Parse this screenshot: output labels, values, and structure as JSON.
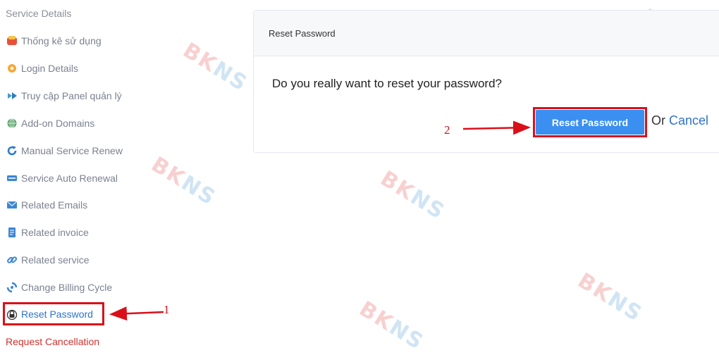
{
  "sidebar": {
    "header": "Service Details",
    "items": [
      {
        "label": "Thống kê sử dụng",
        "icon": "chart-icon"
      },
      {
        "label": "Login Details",
        "icon": "gear-icon"
      },
      {
        "label": "Truy cập Panel quản lý",
        "icon": "arrow-right-icon"
      },
      {
        "label": "Add-on Domains",
        "icon": "globe-icon"
      },
      {
        "label": "Manual Service Renew",
        "icon": "refresh-icon"
      },
      {
        "label": "Service Auto Renewal",
        "icon": "auto-badge-icon"
      },
      {
        "label": "Related Emails",
        "icon": "envelope-icon"
      },
      {
        "label": "Related invoice",
        "icon": "document-icon"
      },
      {
        "label": "Related service",
        "icon": "link-icon"
      },
      {
        "label": "Change Billing Cycle",
        "icon": "cycle-icon"
      },
      {
        "label": "Reset Password",
        "icon": "lock-icon"
      },
      {
        "label": "Request Cancellation",
        "icon": ""
      }
    ]
  },
  "panel": {
    "title": "Reset Password",
    "question": "Do you really want to reset your password?",
    "reset_button": "Reset Password",
    "or_text": "Or",
    "cancel_link": "Cancel"
  },
  "annotations": {
    "step1": "1",
    "step2": "2"
  },
  "watermark": {
    "text_a": "BK",
    "text_b": "NS"
  },
  "colors": {
    "accent": "#3b8ff0",
    "link": "#2e73c8",
    "highlight": "#d9101a",
    "danger": "#d0312d"
  }
}
